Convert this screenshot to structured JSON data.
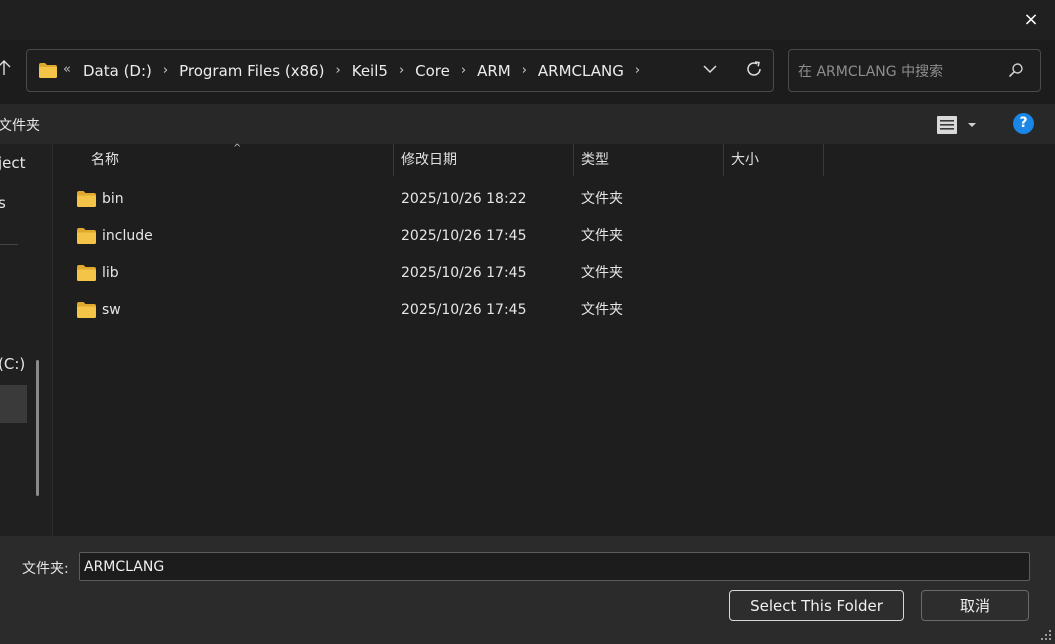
{
  "window": {
    "close_icon": "×"
  },
  "address": {
    "overflow": "«",
    "crumbs": [
      "Data (D:)",
      "Program Files (x86)",
      "Keil5",
      "Core",
      "ARM",
      "ARMCLANG"
    ]
  },
  "search": {
    "placeholder": "在 ARMCLANG 中搜索"
  },
  "toolbar": {
    "new_folder": "文件夹"
  },
  "nav": {
    "item_project": "ject",
    "item_s": "s",
    "item_c": "(C:)"
  },
  "columns": {
    "name": "名称",
    "modified": "修改日期",
    "type": "类型",
    "size": "大小"
  },
  "files": [
    {
      "name": "bin",
      "modified": "2025/10/26 18:22",
      "type": "文件夹",
      "size": ""
    },
    {
      "name": "include",
      "modified": "2025/10/26 17:45",
      "type": "文件夹",
      "size": ""
    },
    {
      "name": "lib",
      "modified": "2025/10/26 17:45",
      "type": "文件夹",
      "size": ""
    },
    {
      "name": "sw",
      "modified": "2025/10/26 17:45",
      "type": "文件夹",
      "size": ""
    }
  ],
  "footer": {
    "folder_label": "文件夹:",
    "folder_value": "ARMCLANG",
    "select_label": "Select This Folder",
    "cancel_label": "取消"
  },
  "colors": {
    "folder": "#f3c447",
    "folder_dark": "#e0a92e",
    "accent": "#1a86e5"
  }
}
